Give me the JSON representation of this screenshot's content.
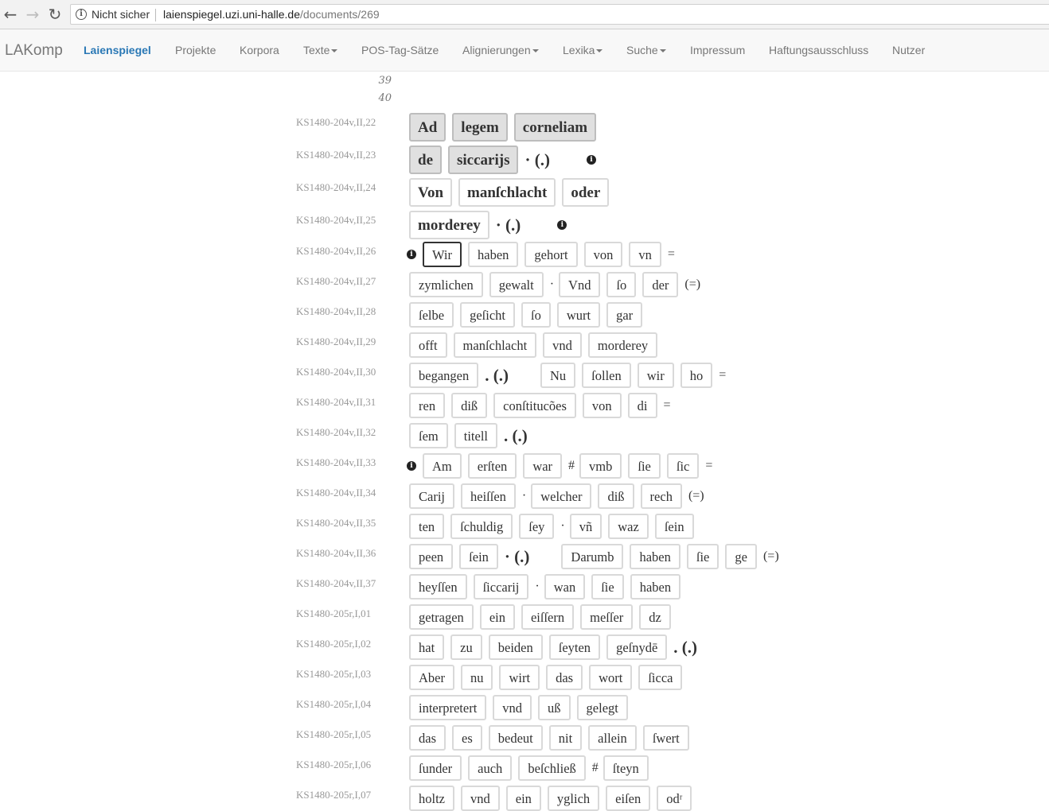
{
  "browser": {
    "back_icon": "←",
    "forward_icon": "→",
    "reload_icon": "↻",
    "security_label": "Nicht sicher",
    "url_host": "laienspiegel.uzi.uni-halle.de",
    "url_path": "/documents/269"
  },
  "navbar": {
    "brand": "LAKomp",
    "items": [
      {
        "label": "Laienspiegel",
        "active": true,
        "dropdown": false
      },
      {
        "label": "Projekte",
        "dropdown": false
      },
      {
        "label": "Korpora",
        "dropdown": false
      },
      {
        "label": "Texte",
        "dropdown": true
      },
      {
        "label": "POS-Tag-Sätze",
        "dropdown": false
      },
      {
        "label": "Alignierungen",
        "dropdown": true
      },
      {
        "label": "Lexika",
        "dropdown": true
      },
      {
        "label": "Suche",
        "dropdown": true
      },
      {
        "label": "Impressum",
        "dropdown": false
      },
      {
        "label": "Haftungsausschluss",
        "dropdown": false
      },
      {
        "label": "Nutzer",
        "dropdown": false
      }
    ]
  },
  "line_numbers": [
    "39",
    "40"
  ],
  "lines": [
    {
      "ref": "KS1480-204v,II,22",
      "big": true,
      "items": [
        {
          "t": "tok",
          "v": "Ad",
          "style": "gray"
        },
        {
          "t": "tok",
          "v": "legem",
          "style": "gray"
        },
        {
          "t": "tok",
          "v": "corneliam",
          "style": "gray"
        }
      ]
    },
    {
      "ref": "KS1480-204v,II,23",
      "big": true,
      "items": [
        {
          "t": "tok",
          "v": "de",
          "style": "gray"
        },
        {
          "t": "tok",
          "v": "siccarijs",
          "style": "gray"
        },
        {
          "t": "p",
          "v": "· (.)"
        },
        {
          "t": "info",
          "pos": "trail"
        }
      ]
    },
    {
      "ref": "KS1480-204v,II,24",
      "big": true,
      "items": [
        {
          "t": "tok",
          "v": "Von"
        },
        {
          "t": "tok",
          "v": "manſchlacht"
        },
        {
          "t": "tok",
          "v": "oder"
        }
      ]
    },
    {
      "ref": "KS1480-204v,II,25",
      "big": true,
      "items": [
        {
          "t": "tok",
          "v": "morderey"
        },
        {
          "t": "p",
          "v": "· (.)"
        },
        {
          "t": "info",
          "pos": "trail"
        }
      ]
    },
    {
      "ref": "KS1480-204v,II,26",
      "items": [
        {
          "t": "info",
          "pos": "lead"
        },
        {
          "t": "tok",
          "v": "Wir",
          "style": "sel"
        },
        {
          "t": "tok",
          "v": "haben"
        },
        {
          "t": "tok",
          "v": "gehort"
        },
        {
          "t": "tok",
          "v": "von"
        },
        {
          "t": "tok",
          "v": "vn"
        },
        {
          "t": "p",
          "v": "="
        }
      ]
    },
    {
      "ref": "KS1480-204v,II,27",
      "items": [
        {
          "t": "tok",
          "v": "zymlichen"
        },
        {
          "t": "tok",
          "v": "gewalt"
        },
        {
          "t": "p",
          "v": "·"
        },
        {
          "t": "tok",
          "v": "Vnd"
        },
        {
          "t": "tok",
          "v": "ſo"
        },
        {
          "t": "tok",
          "v": "der"
        },
        {
          "t": "p",
          "v": "(=)"
        }
      ]
    },
    {
      "ref": "KS1480-204v,II,28",
      "items": [
        {
          "t": "tok",
          "v": "ſelbe"
        },
        {
          "t": "tok",
          "v": "geſicht"
        },
        {
          "t": "tok",
          "v": "ſo"
        },
        {
          "t": "tok",
          "v": "wurt"
        },
        {
          "t": "tok",
          "v": "gar"
        }
      ]
    },
    {
      "ref": "KS1480-204v,II,29",
      "items": [
        {
          "t": "tok",
          "v": "offt"
        },
        {
          "t": "tok",
          "v": "manſchlacht"
        },
        {
          "t": "tok",
          "v": "vnd"
        },
        {
          "t": "tok",
          "v": "morderey"
        }
      ]
    },
    {
      "ref": "KS1480-204v,II,30",
      "items": [
        {
          "t": "tok",
          "v": "begangen"
        },
        {
          "t": "p",
          "v": ". (.)",
          "big": true
        },
        {
          "t": "gap"
        },
        {
          "t": "tok",
          "v": "Nu"
        },
        {
          "t": "tok",
          "v": "ſollen"
        },
        {
          "t": "tok",
          "v": "wir"
        },
        {
          "t": "tok",
          "v": "ho"
        },
        {
          "t": "p",
          "v": "="
        }
      ]
    },
    {
      "ref": "KS1480-204v,II,31",
      "items": [
        {
          "t": "tok",
          "v": "ren"
        },
        {
          "t": "tok",
          "v": "diß"
        },
        {
          "t": "tok",
          "v": "conſtitucões"
        },
        {
          "t": "tok",
          "v": "von"
        },
        {
          "t": "tok",
          "v": "di"
        },
        {
          "t": "p",
          "v": "="
        }
      ]
    },
    {
      "ref": "KS1480-204v,II,32",
      "items": [
        {
          "t": "tok",
          "v": "ſem"
        },
        {
          "t": "tok",
          "v": "titell"
        },
        {
          "t": "p",
          "v": ". (.)",
          "big": true
        }
      ]
    },
    {
      "ref": "KS1480-204v,II,33",
      "items": [
        {
          "t": "info",
          "pos": "lead"
        },
        {
          "t": "tok",
          "v": "Am"
        },
        {
          "t": "tok",
          "v": "erſten"
        },
        {
          "t": "tok",
          "v": "war"
        },
        {
          "t": "p",
          "v": "#"
        },
        {
          "t": "tok",
          "v": "vmb"
        },
        {
          "t": "tok",
          "v": "ſie"
        },
        {
          "t": "tok",
          "v": "ſic"
        },
        {
          "t": "p",
          "v": "="
        }
      ]
    },
    {
      "ref": "KS1480-204v,II,34",
      "items": [
        {
          "t": "tok",
          "v": "Carij"
        },
        {
          "t": "tok",
          "v": "heiſſen"
        },
        {
          "t": "p",
          "v": "·"
        },
        {
          "t": "tok",
          "v": "welcher"
        },
        {
          "t": "tok",
          "v": "diß"
        },
        {
          "t": "tok",
          "v": "rech"
        },
        {
          "t": "p",
          "v": "(=)"
        }
      ]
    },
    {
      "ref": "KS1480-204v,II,35",
      "items": [
        {
          "t": "tok",
          "v": "ten"
        },
        {
          "t": "tok",
          "v": "ſchuldig"
        },
        {
          "t": "tok",
          "v": "ſey"
        },
        {
          "t": "p",
          "v": "·"
        },
        {
          "t": "tok",
          "v": "vñ"
        },
        {
          "t": "tok",
          "v": "waz"
        },
        {
          "t": "tok",
          "v": "ſein"
        }
      ]
    },
    {
      "ref": "KS1480-204v,II,36",
      "items": [
        {
          "t": "tok",
          "v": "peen"
        },
        {
          "t": "tok",
          "v": "ſein"
        },
        {
          "t": "p",
          "v": "· (.)",
          "big": true
        },
        {
          "t": "gap"
        },
        {
          "t": "tok",
          "v": "Darumb"
        },
        {
          "t": "tok",
          "v": "haben"
        },
        {
          "t": "tok",
          "v": "ſie"
        },
        {
          "t": "tok",
          "v": "ge"
        },
        {
          "t": "p",
          "v": "(=)"
        }
      ]
    },
    {
      "ref": "KS1480-204v,II,37",
      "items": [
        {
          "t": "tok",
          "v": "heyſſen"
        },
        {
          "t": "tok",
          "v": "ſiccarij"
        },
        {
          "t": "p",
          "v": "·"
        },
        {
          "t": "tok",
          "v": "wan"
        },
        {
          "t": "tok",
          "v": "ſie"
        },
        {
          "t": "tok",
          "v": "haben"
        }
      ]
    },
    {
      "ref": "KS1480-205r,I,01",
      "items": [
        {
          "t": "tok",
          "v": "getragen"
        },
        {
          "t": "tok",
          "v": "ein"
        },
        {
          "t": "tok",
          "v": "eiſſern"
        },
        {
          "t": "tok",
          "v": "meſſer"
        },
        {
          "t": "tok",
          "v": "dz"
        }
      ]
    },
    {
      "ref": "KS1480-205r,I,02",
      "items": [
        {
          "t": "tok",
          "v": "hat"
        },
        {
          "t": "tok",
          "v": "zu"
        },
        {
          "t": "tok",
          "v": "beiden"
        },
        {
          "t": "tok",
          "v": "ſeyten"
        },
        {
          "t": "tok",
          "v": "geſnydē"
        },
        {
          "t": "p",
          "v": ". (.)",
          "big": true
        }
      ]
    },
    {
      "ref": "KS1480-205r,I,03",
      "items": [
        {
          "t": "tok",
          "v": "Aber"
        },
        {
          "t": "tok",
          "v": "nu"
        },
        {
          "t": "tok",
          "v": "wirt"
        },
        {
          "t": "tok",
          "v": "das"
        },
        {
          "t": "tok",
          "v": "wort"
        },
        {
          "t": "tok",
          "v": "ſicca"
        }
      ]
    },
    {
      "ref": "KS1480-205r,I,04",
      "items": [
        {
          "t": "tok",
          "v": "interpretert"
        },
        {
          "t": "tok",
          "v": "vnd"
        },
        {
          "t": "tok",
          "v": "uß"
        },
        {
          "t": "tok",
          "v": "gelegt"
        }
      ]
    },
    {
      "ref": "KS1480-205r,I,05",
      "items": [
        {
          "t": "tok",
          "v": "das"
        },
        {
          "t": "tok",
          "v": "es"
        },
        {
          "t": "tok",
          "v": "bedeut"
        },
        {
          "t": "tok",
          "v": "nit"
        },
        {
          "t": "tok",
          "v": "allein"
        },
        {
          "t": "tok",
          "v": "ſwert"
        }
      ]
    },
    {
      "ref": "KS1480-205r,I,06",
      "items": [
        {
          "t": "tok",
          "v": "ſunder"
        },
        {
          "t": "tok",
          "v": "auch"
        },
        {
          "t": "tok",
          "v": "beſchließ"
        },
        {
          "t": "p",
          "v": "#"
        },
        {
          "t": "tok",
          "v": "ſteyn"
        }
      ]
    },
    {
      "ref": "KS1480-205r,I,07",
      "items": [
        {
          "t": "tok",
          "v": "holtz"
        },
        {
          "t": "tok",
          "v": "vnd"
        },
        {
          "t": "tok",
          "v": "ein"
        },
        {
          "t": "tok",
          "v": "yglich"
        },
        {
          "t": "tok",
          "v": "eiſen"
        },
        {
          "t": "tok",
          "v": "odʳ"
        }
      ]
    }
  ]
}
